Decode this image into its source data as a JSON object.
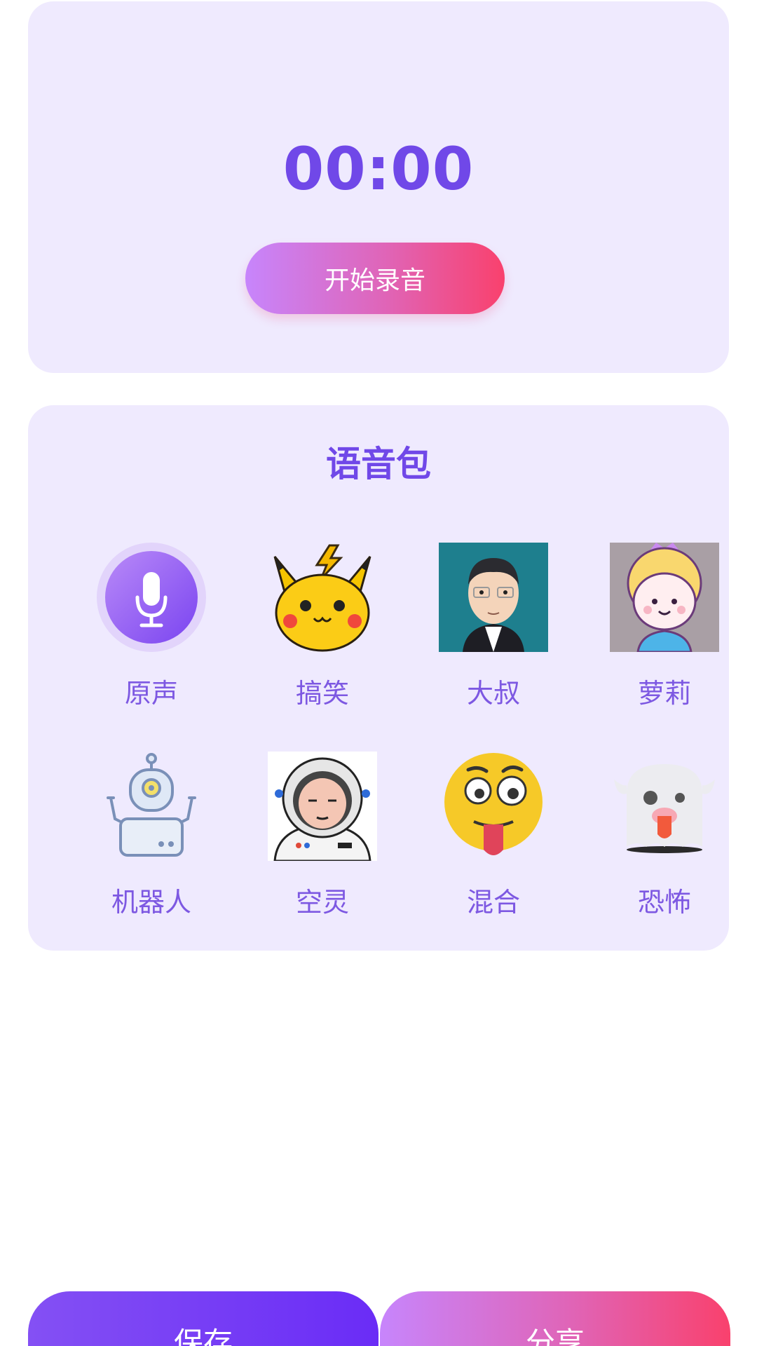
{
  "recorder": {
    "timer": "00:00",
    "record_button_label": "开始录音"
  },
  "voice_pack": {
    "title": "语音包",
    "items": [
      {
        "label": "原声",
        "icon": "microphone-icon"
      },
      {
        "label": "搞笑",
        "icon": "pikachu-icon"
      },
      {
        "label": "大叔",
        "icon": "uncle-avatar-icon"
      },
      {
        "label": "萝莉",
        "icon": "girl-princess-icon"
      },
      {
        "label": "机器人",
        "icon": "robot-icon"
      },
      {
        "label": "空灵",
        "icon": "astronaut-icon"
      },
      {
        "label": "混合",
        "icon": "tongue-emoji-icon"
      },
      {
        "label": "恐怖",
        "icon": "ghost-icon"
      }
    ]
  },
  "actions": {
    "save_label": "保存",
    "share_label": "分享"
  },
  "colors": {
    "accent": "#7048e8",
    "card_bg": "#efeafe",
    "gradient_start": "#c785fc",
    "gradient_end": "#f9416d",
    "save_gradient_start": "#8450f4",
    "save_gradient_end": "#6a2cf6"
  }
}
